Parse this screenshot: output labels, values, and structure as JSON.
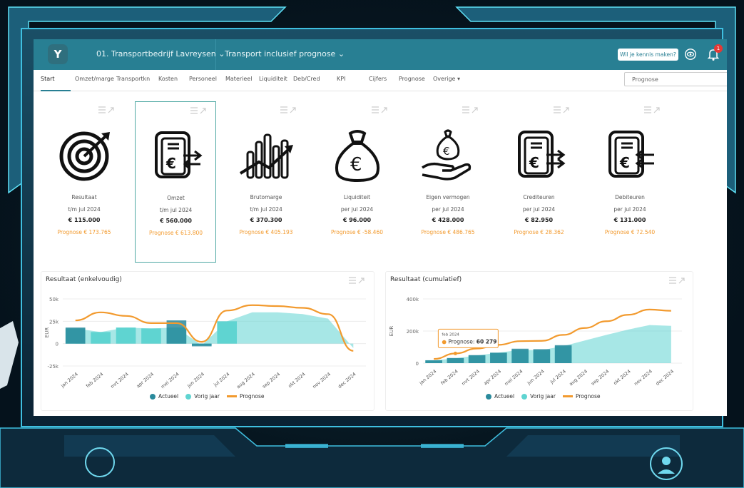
{
  "header": {
    "logo_letter": "Y",
    "company": "01. Transportbedrijf Lavreysen ⌄",
    "report": "Transport inclusief prognose ⌄",
    "cta": "Wil je kennis maken?",
    "notification_count": "1"
  },
  "tabs": [
    "Start",
    "Omzet/marge",
    "Transportkn",
    "Kosten",
    "Personeel",
    "Materieel",
    "Liquiditeit",
    "Deb/Cred",
    "KPI",
    "Cijfers",
    "Prognose",
    "Overige ▾"
  ],
  "scenario_select": {
    "value": "Prognose"
  },
  "cards": [
    {
      "icon": "target-icon",
      "title": "Resultaat",
      "period": "t/m jul 2024",
      "value": "€ 115.000",
      "forecast": "Prognose € 173.765"
    },
    {
      "icon": "document-euro-icon",
      "title": "Omzet",
      "period": "t/m jul 2024",
      "value": "€ 560.000",
      "forecast": "Prognose € 613.800"
    },
    {
      "icon": "bar-growth-icon",
      "title": "Brutomarge",
      "period": "t/m jul 2024",
      "value": "€ 370.300",
      "forecast": "Prognose € 405.193"
    },
    {
      "icon": "money-bag-icon",
      "title": "Liquiditeit",
      "period": "per jul 2024",
      "value": "€ 96.000",
      "forecast": "Prognose € -58.460"
    },
    {
      "icon": "hand-money-icon",
      "title": "Eigen vermogen",
      "period": "per jul 2024",
      "value": "€ 428.000",
      "forecast": "Prognose € 486.765"
    },
    {
      "icon": "document-out-icon",
      "title": "Crediteuren",
      "period": "per jul 2024",
      "value": "€ 82.950",
      "forecast": "Prognose € 28.362"
    },
    {
      "icon": "document-in-icon",
      "title": "Debiteuren",
      "period": "per jul 2024",
      "value": "€ 131.000",
      "forecast": "Prognose € 72.540"
    }
  ],
  "legend": {
    "actual": "Actueel",
    "previous": "Vorig jaar",
    "forecast": "Prognose"
  },
  "colors": {
    "actual": "#2a8a9c",
    "previous": "#5fd4d1",
    "forecast": "#f29a2e",
    "topbar": "#287f93"
  },
  "tooltip": {
    "period": "feb 2024",
    "label": "Prognose:",
    "value": "60 279"
  },
  "chart_data": [
    {
      "type": "bar",
      "title": "Resultaat (enkelvoudig)",
      "ylabel": "EUR",
      "ylim": [
        -25000,
        50000
      ],
      "yticks": [
        "50k",
        "25k",
        "0",
        "-25k"
      ],
      "categories": [
        "jan 2024",
        "feb 2024",
        "mrt 2024",
        "apr 2024",
        "mei 2024",
        "jun 2024",
        "jul 2024",
        "aug 2024",
        "sep 2024",
        "okt 2024",
        "nov 2024",
        "dec 2024"
      ],
      "series": [
        {
          "name": "Actueel",
          "values": [
            18000,
            null,
            null,
            null,
            26000,
            -3000,
            null,
            null,
            null,
            null,
            null,
            null
          ]
        },
        {
          "name": "Vorig jaar",
          "values": [
            17000,
            13000,
            18000,
            17000,
            18000,
            -2000,
            25000,
            35000,
            35000,
            33000,
            28000,
            -5000
          ]
        },
        {
          "name": "Prognose",
          "values": [
            26000,
            35000,
            31000,
            23000,
            23000,
            2000,
            37000,
            43000,
            42000,
            40000,
            33000,
            -8000
          ]
        }
      ]
    },
    {
      "type": "bar",
      "title": "Resultaat (cumulatief)",
      "ylabel": "EUR",
      "ylim": [
        0,
        400000
      ],
      "yticks": [
        "400k",
        "200k",
        "0"
      ],
      "categories": [
        "jan 2024",
        "feb 2024",
        "mrt 2024",
        "apr 2024",
        "mei 2024",
        "jun 2024",
        "jul 2024",
        "aug 2024",
        "sep 2024",
        "okt 2024",
        "nov 2024",
        "dec 2024"
      ],
      "series": [
        {
          "name": "Actueel",
          "values": [
            18000,
            32000,
            50000,
            65000,
            90000,
            87000,
            112000,
            null,
            null,
            null,
            null,
            null
          ]
        },
        {
          "name": "Vorig jaar",
          "values": [
            17000,
            30000,
            48000,
            65000,
            83000,
            81000,
            106000,
            141000,
            176000,
            209000,
            237000,
            232000
          ]
        },
        {
          "name": "Prognose",
          "values": [
            26000,
            60279,
            91000,
            114000,
            137000,
            139000,
            176000,
            219000,
            261000,
            301000,
            334000,
            326000
          ]
        }
      ]
    }
  ]
}
